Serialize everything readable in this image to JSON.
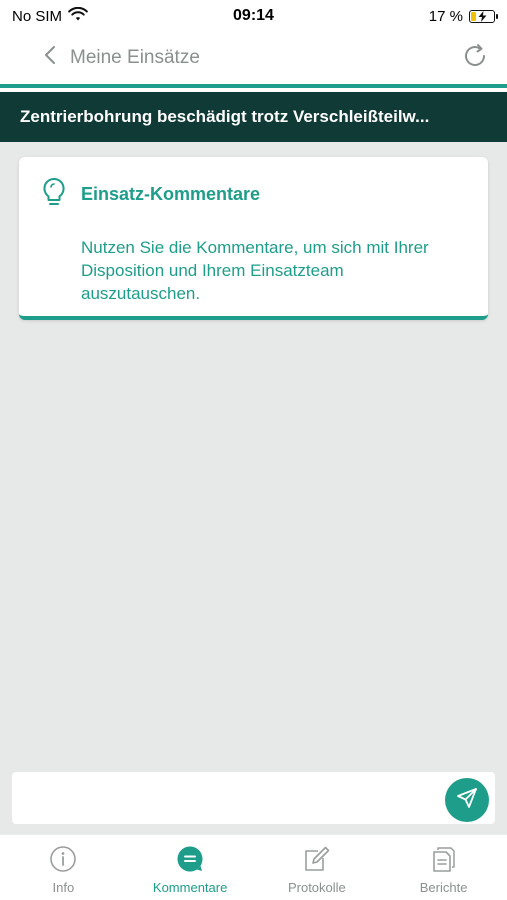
{
  "status_bar": {
    "carrier": "No SIM",
    "time": "09:14",
    "battery": "17 %"
  },
  "nav": {
    "back_label": "Meine Einsätze"
  },
  "title": "Zentrierbohrung beschädigt trotz Verschleißteilw...",
  "info_card": {
    "title": "Einsatz-Kommentare",
    "text": "Nutzen Sie die Kommentare, um sich mit Ihrer Disposition und Ihrem Einsatzteam auszutauschen."
  },
  "input": {
    "value": "",
    "placeholder": ""
  },
  "tabs": [
    {
      "label": "Info",
      "icon": "info-icon",
      "active": false
    },
    {
      "label": "Kommentare",
      "icon": "comment-icon",
      "active": true
    },
    {
      "label": "Protokolle",
      "icon": "edit-icon",
      "active": false
    },
    {
      "label": "Berichte",
      "icon": "document-icon",
      "active": false
    }
  ],
  "colors": {
    "accent": "#1e9e8a",
    "banner": "#0f3a35",
    "content_bg": "#e7e8e8"
  }
}
